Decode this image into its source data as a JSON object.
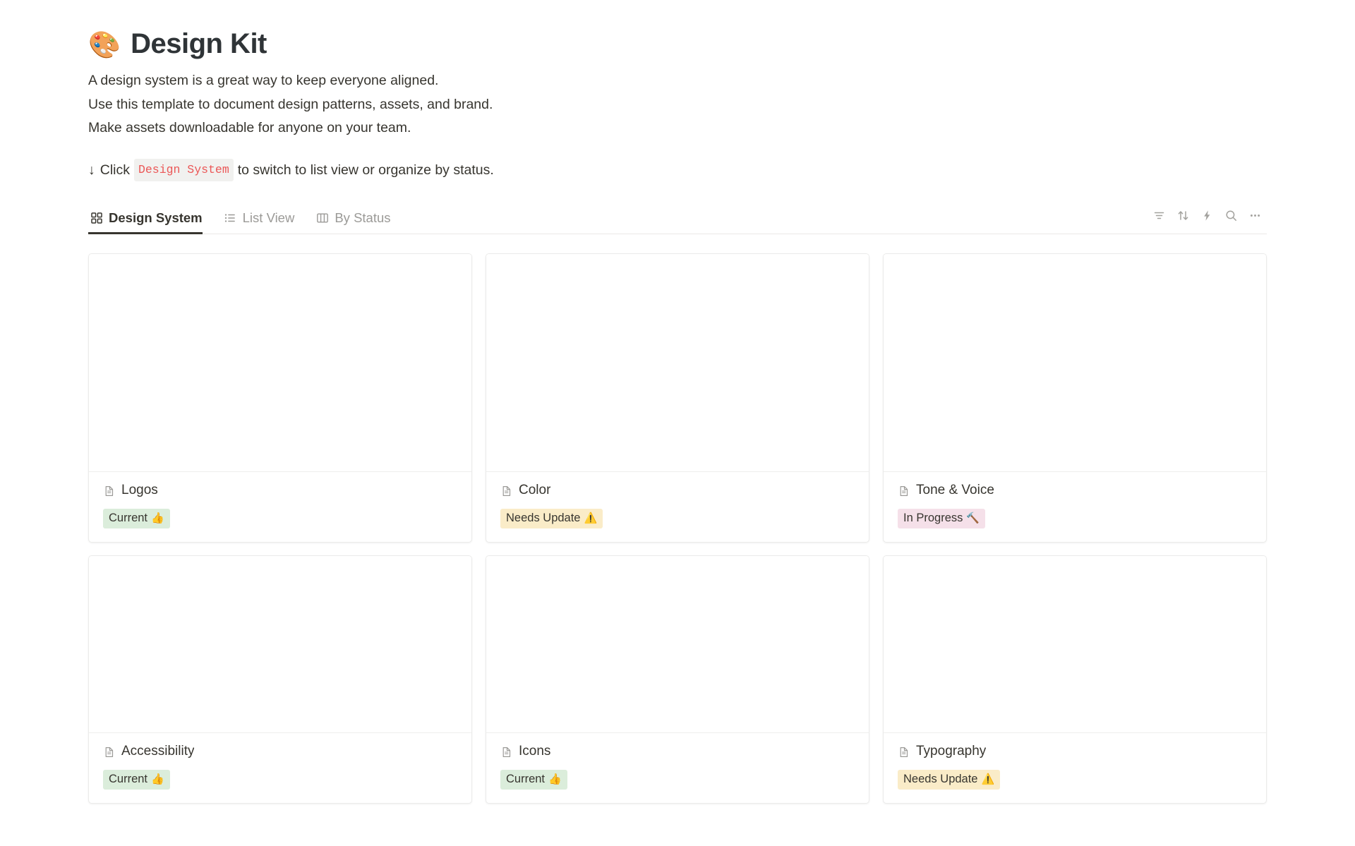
{
  "header": {
    "emoji": "🎨",
    "emoji_name": "artist-palette-emoji",
    "title": "Design Kit",
    "description_lines": [
      "A design system is a great way to keep everyone aligned.",
      "Use this template to document design patterns, assets, and brand.",
      "Make assets downloadable for anyone on your team."
    ],
    "callout": {
      "arrow": "↓",
      "prefix": "Click",
      "code": "Design System",
      "suffix": "to switch to list view or organize by status."
    }
  },
  "tabs": [
    {
      "label": "Design System",
      "icon": "grid-icon",
      "active": true
    },
    {
      "label": "List View",
      "icon": "list-icon",
      "active": false
    },
    {
      "label": "By Status",
      "icon": "board-icon",
      "active": false
    }
  ],
  "toolbar": [
    {
      "name": "filter-icon",
      "label": "Filter"
    },
    {
      "name": "sort-icon",
      "label": "Sort"
    },
    {
      "name": "lightning-icon",
      "label": "Automations"
    },
    {
      "name": "search-icon",
      "label": "Search"
    },
    {
      "name": "more-icon",
      "label": "More options"
    }
  ],
  "statuses": {
    "current": {
      "label": "Current",
      "emoji": "👍",
      "bg": "#dbeddb",
      "fg": "#37352f"
    },
    "needs_update": {
      "label": "Needs Update",
      "emoji": "⚠️",
      "bg": "#faecc8",
      "fg": "#37352f"
    },
    "in_progress": {
      "label": "In Progress",
      "emoji": "🔨",
      "bg": "#f5e0e9",
      "fg": "#37352f"
    }
  },
  "cards": [
    {
      "title": "Logos",
      "icon": "page-icon",
      "status_label": "Current",
      "status_emoji": "👍",
      "status_bg": "#dbeddb"
    },
    {
      "title": "Color",
      "icon": "page-icon",
      "status_label": "Needs Update",
      "status_emoji": "⚠️",
      "status_bg": "#faecc8"
    },
    {
      "title": "Tone & Voice",
      "icon": "page-icon",
      "status_label": "In Progress",
      "status_emoji": "🔨",
      "status_bg": "#f5e0e9"
    },
    {
      "title": "Accessibility",
      "icon": "page-icon",
      "status_label": "Current",
      "status_emoji": "👍",
      "status_bg": "#dbeddb"
    },
    {
      "title": "Icons",
      "icon": "page-icon",
      "status_label": "Current",
      "status_emoji": "👍",
      "status_bg": "#dbeddb"
    },
    {
      "title": "Typography",
      "icon": "page-icon",
      "status_label": "Needs Update",
      "status_emoji": "⚠️",
      "status_bg": "#faecc8"
    }
  ]
}
